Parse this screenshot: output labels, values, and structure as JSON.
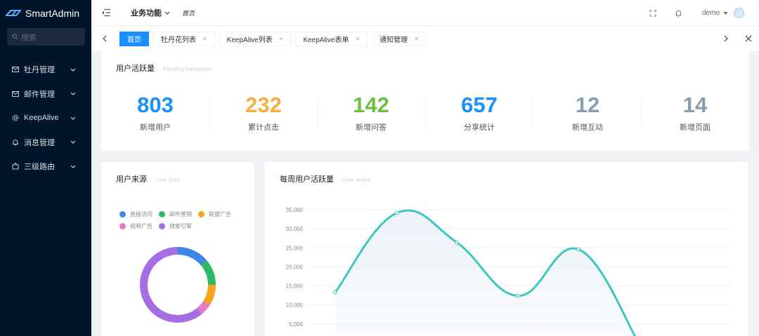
{
  "app": {
    "name": "SmartAdmin"
  },
  "sidebar": {
    "search_placeholder": "搜索",
    "items": [
      {
        "label": "牡丹管理",
        "icon": "mail-icon"
      },
      {
        "label": "邮件管理",
        "icon": "mail-icon"
      },
      {
        "label": "KeepAlive",
        "icon": "gear-icon"
      },
      {
        "label": "消息管理",
        "icon": "bell-icon"
      },
      {
        "label": "三级路由",
        "icon": "puzzle-icon"
      }
    ]
  },
  "header": {
    "menu_label": "业务功能",
    "breadcrumb": "首页",
    "user": "demo"
  },
  "tabs": [
    {
      "label": "首页",
      "active": true
    },
    {
      "label": "牡丹花列表"
    },
    {
      "label": "KeepAlive列表"
    },
    {
      "label": "KeepAlive表单"
    },
    {
      "label": "通知管理"
    }
  ],
  "stats_card": {
    "title": "用户活跃量",
    "subtitle": "Pending transaction",
    "items": [
      {
        "value": "803",
        "label": "新增用户",
        "color": "#1890ff"
      },
      {
        "value": "232",
        "label": "累计点击",
        "color": "#f6b042"
      },
      {
        "value": "142",
        "label": "新增问答",
        "color": "#6cbf45"
      },
      {
        "value": "657",
        "label": "分享统计",
        "color": "#1890ff"
      },
      {
        "value": "12",
        "label": "新增互动",
        "color": "#8a9eb2"
      },
      {
        "value": "14",
        "label": "新增页面",
        "color": "#8a9eb2"
      }
    ]
  },
  "source_card": {
    "title": "用户来源",
    "subtitle": "User from"
  },
  "active_card": {
    "title": "每周用户活跃量",
    "subtitle": "User active"
  },
  "chart_data": [
    {
      "type": "pie",
      "variant": "donut",
      "legend": "top-left",
      "series": [
        {
          "name": "直接访问",
          "value": 14,
          "color": "#3b87e3"
        },
        {
          "name": "邮件营销",
          "value": 11,
          "color": "#2db865"
        },
        {
          "name": "联盟广告",
          "value": 9,
          "color": "#f7a21b"
        },
        {
          "name": "视频广告",
          "value": 5,
          "color": "#e57bc6"
        },
        {
          "name": "搜索引擎",
          "value": 61,
          "color": "#a56ee4"
        }
      ]
    },
    {
      "type": "line",
      "smooth": true,
      "area": true,
      "color": "#3cc6c2",
      "y_ticks": [
        "35,000",
        "30,000",
        "25,000",
        "20,000",
        "15,000",
        "10,000",
        "5,000"
      ],
      "ylim": [
        0,
        35000
      ],
      "values": [
        13300,
        34200,
        26400,
        12400,
        24600,
        0
      ],
      "grid": true
    }
  ]
}
